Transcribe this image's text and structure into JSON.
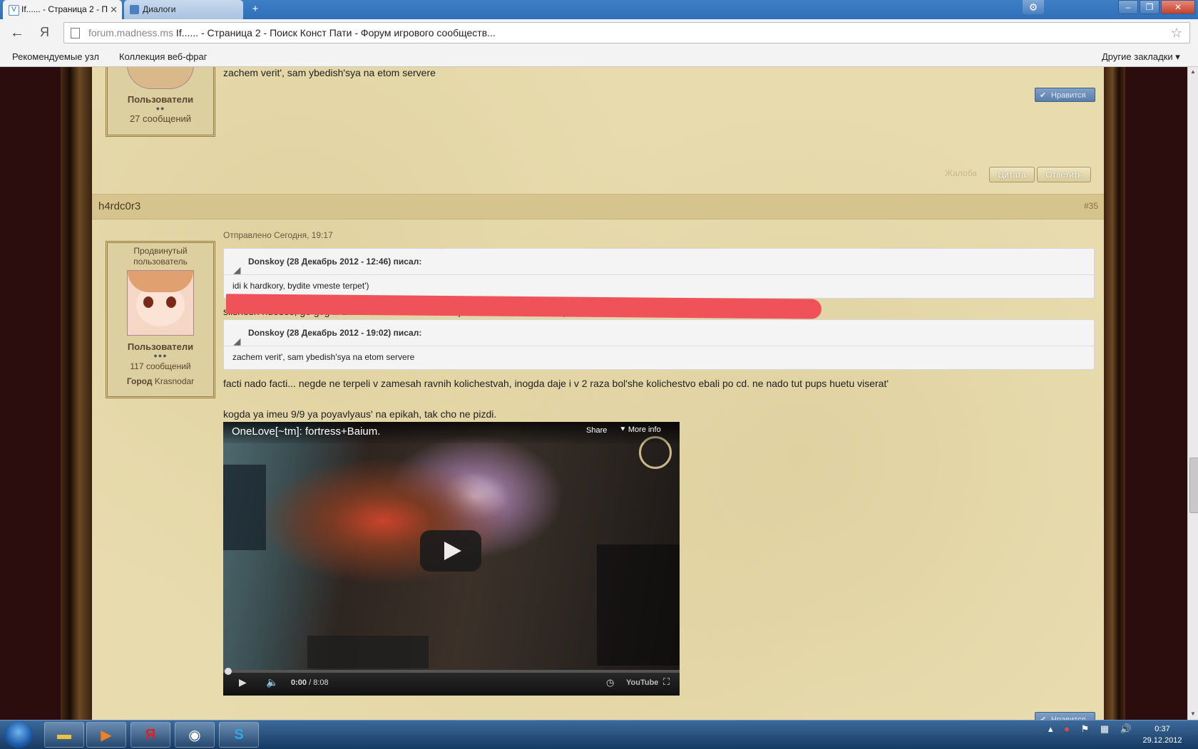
{
  "browser": {
    "tabs": [
      {
        "label": "If...... - Страница 2 - П",
        "active": true
      },
      {
        "label": "Диалоги",
        "active": false
      }
    ],
    "url_host": "forum.madness.ms",
    "url_rest": " If...... - Страница 2 - Поиск Конст Пати - Форум игрового сообществ...",
    "yandex_glyph": "Я",
    "bookmarks": [
      "Рекомендуемые узл",
      "Коллекция веб-фраг"
    ],
    "other_bookmarks": "Другие закладки ▾"
  },
  "post_prev": {
    "group": "Пользователи",
    "pips": "●●",
    "messages": "27 сообщений",
    "text": "zachem verit', sam ybedish'sya na etom servere",
    "like": "Нравится",
    "complain": "Жалоба",
    "quote_btn": "Цитата",
    "reply_btn": "Ответить"
  },
  "post": {
    "author": "h4rdc0r3",
    "number": "#35",
    "sent": "Отправлено Сегодня, 19:17",
    "rank": "Продвинутый пользователь",
    "group": "Пользователи",
    "pips": "●●●",
    "messages": "117 сообщений",
    "city_label": "Город",
    "city": "Krasnodar",
    "quote1_head": "Donskoy (28 Декабрь 2012 - 12:46) писал:",
    "quote1_body": "idi k hardkory, bydite vmeste terpet')",
    "line1": "slishesh huesos, go gvg ili zassal na 2 den' servera? posmotrim kto budet terpet', esli ne sol'eshsya ran'she so svoim online v praime.",
    "quote2_head": "Donskoy (28 Декабрь 2012 - 19:02) писал:",
    "quote2_body": "zachem verit', sam ybedish'sya na etom servere",
    "line2": "facti nado facti... negde ne terpeli v zamesah ravnih kolichestvah, inogda daje i v 2 raza bol'she kolichestvo ebali po cd. ne nado tut pups huetu viserat'",
    "line3": "kogda ya imeu 9/9 ya poyavlyaus' na epikah, tak cho ne pizdi.",
    "like_partial": "Нравится"
  },
  "video": {
    "title": "OneLove[~tm]: fortress+Baium.",
    "share": "Share",
    "more_info": "More info",
    "time_current": "0:00",
    "time_total": "/ 8:08",
    "brand": "YouTube"
  },
  "taskbar": {
    "time": "0:37",
    "date": "29.12.2012"
  }
}
